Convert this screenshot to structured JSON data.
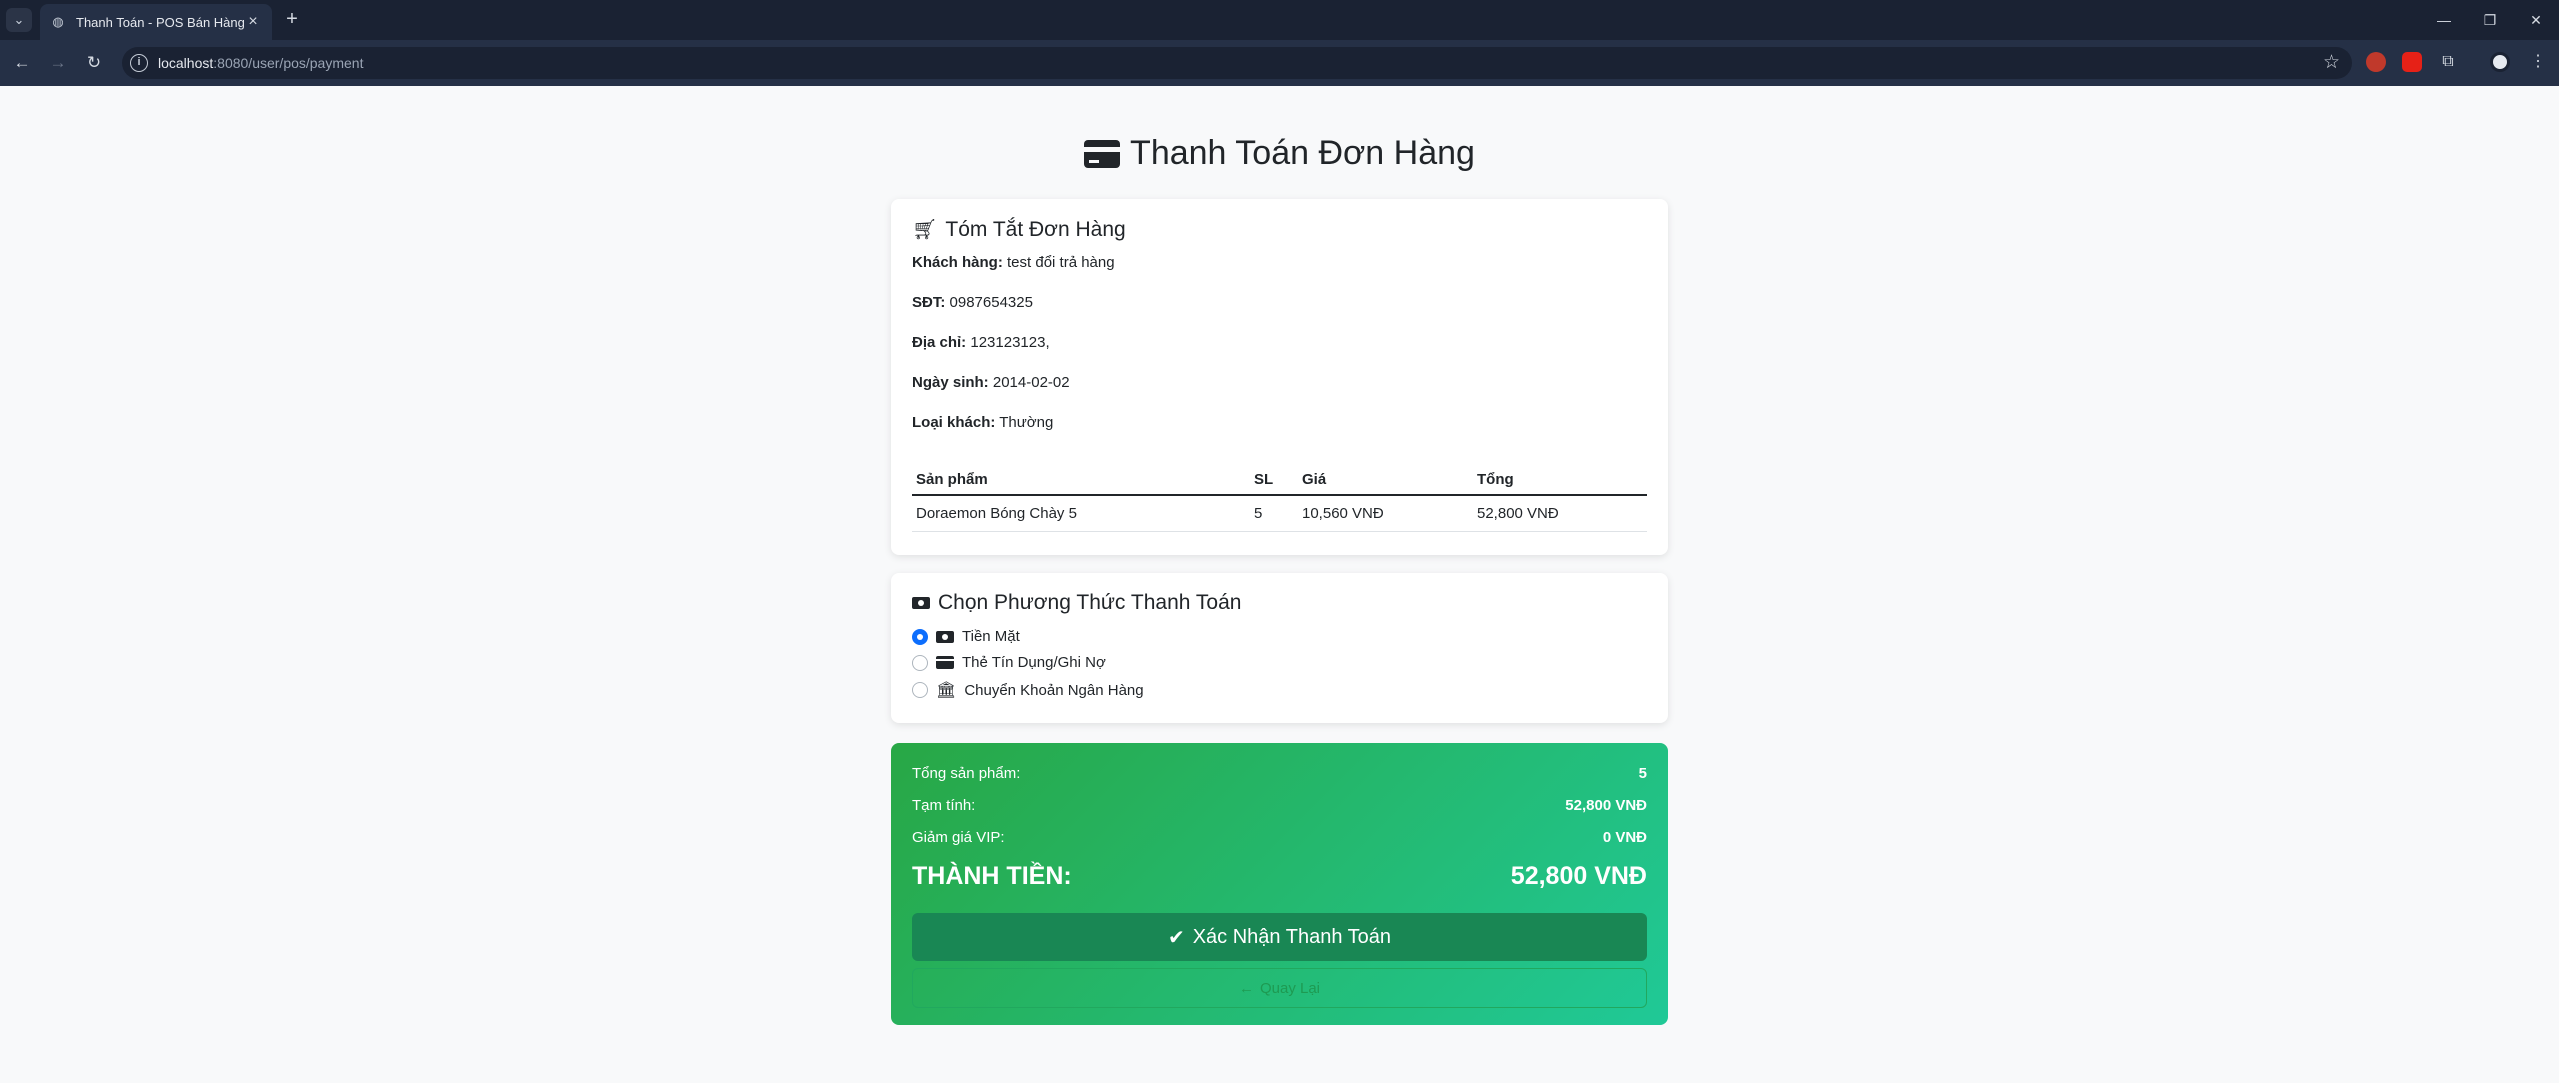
{
  "browser": {
    "tab_title": "Thanh Toán - POS Bán Hàng",
    "url_host": "localhost",
    "url_rest": ":8080/user/pos/payment"
  },
  "page": {
    "title": "Thanh Toán Đơn Hàng"
  },
  "summary": {
    "heading": "Tóm Tắt Đơn Hàng",
    "customer_label": "Khách hàng:",
    "customer_value": "test đổi trả hàng",
    "phone_label": "SĐT:",
    "phone_value": "0987654325",
    "address_label": "Địa chỉ:",
    "address_value": "123123123,",
    "birthday_label": "Ngày sinh:",
    "birthday_value": "2014-02-02",
    "type_label": "Loại khách:",
    "type_value": "Thường",
    "table": {
      "headers": [
        "Sản phẩm",
        "SL",
        "Giá",
        "Tổng"
      ],
      "rows": [
        [
          "Doraemon Bóng Chày 5",
          "5",
          "10,560 VNĐ",
          "52,800 VNĐ"
        ]
      ]
    }
  },
  "payment_method": {
    "heading": "Chọn Phương Thức Thanh Toán",
    "options": [
      {
        "label": "Tiền Mặt",
        "icon": "money-bill-icon",
        "checked": true
      },
      {
        "label": "Thẻ Tín Dụng/Ghi Nợ",
        "icon": "credit-card-icon",
        "checked": false
      },
      {
        "label": "Chuyển Khoản Ngân Hàng",
        "icon": "bank-icon",
        "checked": false
      }
    ]
  },
  "totals": {
    "items_label": "Tổng sản phẩm:",
    "items_value": "5",
    "subtotal_label": "Tạm tính:",
    "subtotal_value": "52,800 VNĐ",
    "vip_label": "Giảm giá VIP:",
    "vip_value": "0 VNĐ",
    "grand_label": "THÀNH TIỀN:",
    "grand_value": "52,800 VNĐ",
    "confirm_label": "Xác Nhận Thanh Toán",
    "back_label": "Quay Lại"
  },
  "colors": {
    "total_gradient_start": "#28a745",
    "total_gradient_end": "#20c997",
    "confirm_button": "#198754",
    "radio_checked": "#0d6efd"
  }
}
